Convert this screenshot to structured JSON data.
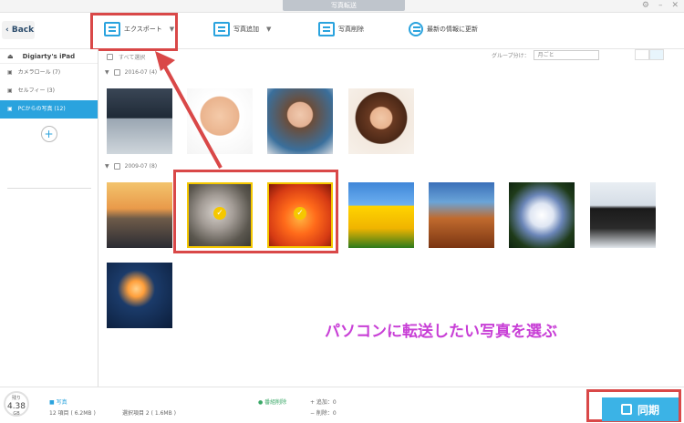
{
  "window": {
    "title": "写真転送"
  },
  "toolbar": {
    "back_label": "Back",
    "export_label": "エクスポート",
    "add_label": "写真追加",
    "delete_label": "写真削除",
    "refresh_label": "最新の情報に更新"
  },
  "sidebar": {
    "device_name": "Digiarty's iPad",
    "items": [
      {
        "label": "カメラロール (7)"
      },
      {
        "label": "セルフィー (3)"
      },
      {
        "label": "PCからの写真 (12)"
      }
    ]
  },
  "content": {
    "select_all_label": "すべて選択",
    "group_label": "グループ分け：",
    "group_value": "月ごと",
    "groups": [
      {
        "header": "2016-07 (4)"
      },
      {
        "header": "2009-07 (8)"
      }
    ],
    "caption": "パソコンに転送したい写真を選ぶ"
  },
  "status": {
    "storage_label": "残り",
    "storage_value": "4.38",
    "storage_unit": "GB",
    "category": "写真",
    "items_total": "12 項目 ( 6.2MB )",
    "items_selected": "選択項目 2 ( 1.6MB )",
    "sync_changes": "● 番組削除",
    "add_count": "+ 追加：0",
    "del_count": "− 削除：0",
    "sync_label": "同期"
  },
  "colors": {
    "accent": "#2aa3de",
    "highlight": "#d94848",
    "caption": "#c83fd6",
    "check": "#f5c800"
  }
}
